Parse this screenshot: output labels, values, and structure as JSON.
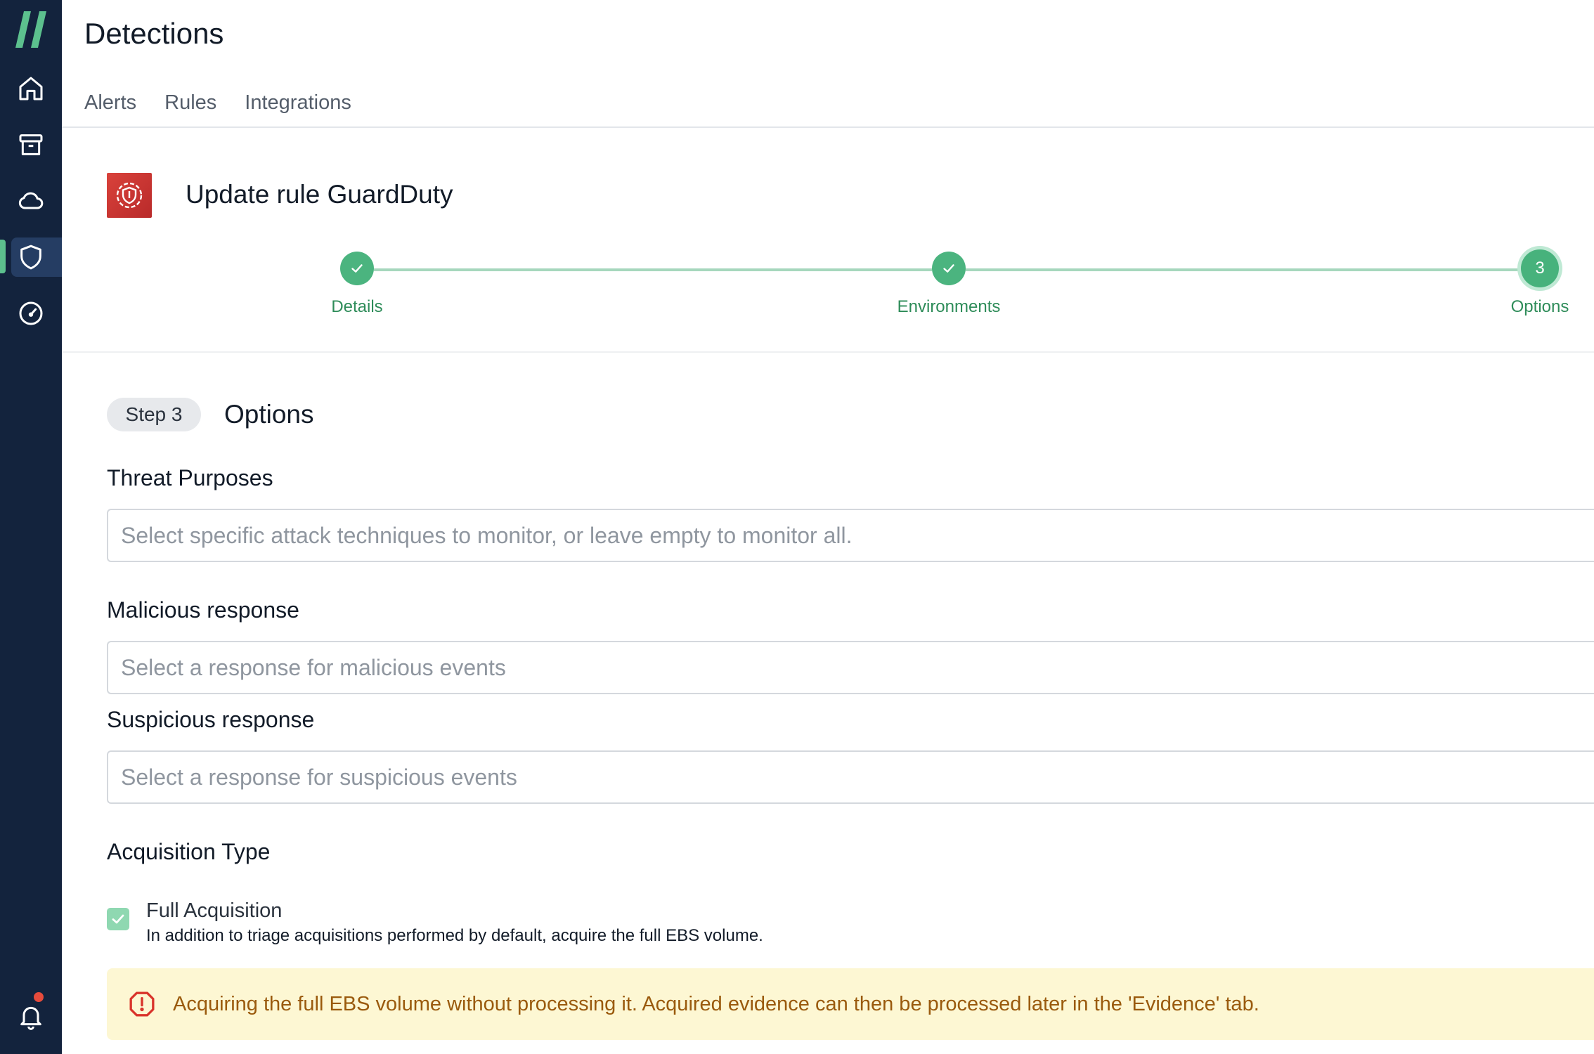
{
  "sidebar": {
    "items": [
      {
        "icon": "home-icon"
      },
      {
        "icon": "archive-icon"
      },
      {
        "icon": "cloud-icon"
      },
      {
        "icon": "shield-icon",
        "active": true
      },
      {
        "icon": "gauge-icon"
      }
    ],
    "notification_icon": "bell-icon"
  },
  "header": {
    "title": "Detections",
    "tabs": [
      "Alerts",
      "Rules",
      "Integrations"
    ]
  },
  "rule": {
    "title": "Update rule GuardDuty"
  },
  "stepper": {
    "steps": [
      {
        "label": "Details",
        "status": "complete"
      },
      {
        "label": "Environments",
        "status": "complete"
      },
      {
        "label": "Options",
        "status": "current",
        "number": "3"
      }
    ]
  },
  "step": {
    "pill": "Step 3",
    "heading": "Options"
  },
  "form": {
    "threat_purposes": {
      "label": "Threat Purposes",
      "placeholder": "Select specific attack techniques to monitor, or leave empty to monitor all."
    },
    "malicious_response": {
      "label": "Malicious response",
      "placeholder": "Select a response for malicious events"
    },
    "suspicious_response": {
      "label": "Suspicious response",
      "placeholder": "Select a response for suspicious events"
    },
    "acquisition_type": {
      "label": "Acquisition Type",
      "option_title": "Full Acquisition",
      "option_description": "In addition to triage acquisitions performed by default, acquire the full EBS volume.",
      "checked": true
    }
  },
  "warning": {
    "text": "Acquiring the full EBS volume without processing it. Acquired evidence can then be processed later in the 'Evidence' tab."
  },
  "colors": {
    "sidebar": "#13233d",
    "accent_green": "#4bb47f",
    "warning_bg": "#fdf7d3",
    "warning_text": "#9a5a0d"
  }
}
